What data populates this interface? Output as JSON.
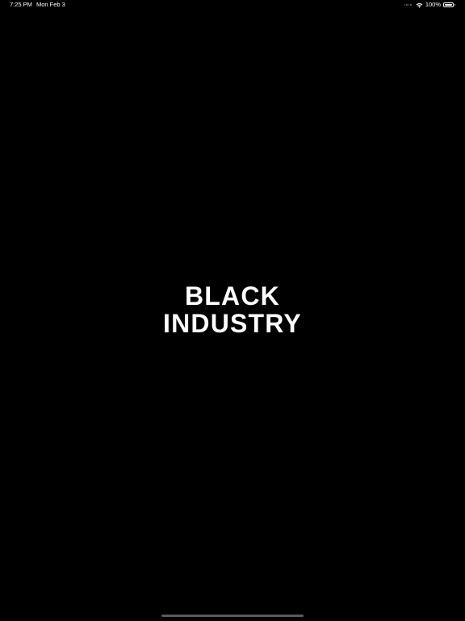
{
  "status_bar": {
    "time": "7:25 PM",
    "date": "Mon Feb 3",
    "battery_percent": "100%",
    "battery_level": 1.0,
    "icons": [
      "signal-dots-icon",
      "wifi-icon",
      "battery-icon"
    ]
  },
  "logo": {
    "line1": "BLACK",
    "line2": "INDUSTRY"
  },
  "colors": {
    "background": "#000000",
    "text": "#ffffff",
    "home_indicator": "#5a5a5a"
  }
}
